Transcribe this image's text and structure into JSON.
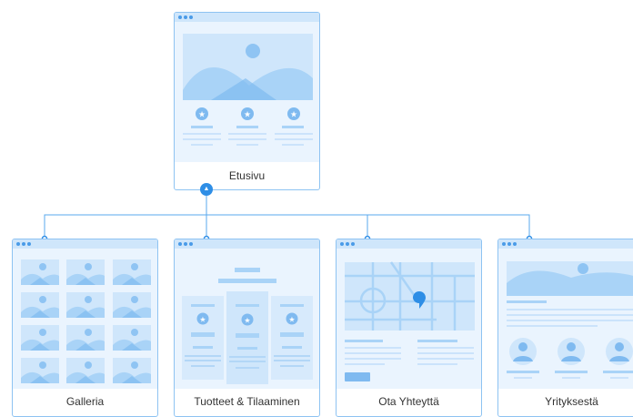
{
  "pages": {
    "home": {
      "label": "Etusivu"
    },
    "gallery": {
      "label": "Galleria"
    },
    "products": {
      "label": "Tuotteet & Tilaaminen"
    },
    "contact": {
      "label": "Ota Yhteyttä"
    },
    "about": {
      "label": "Yrityksestä"
    }
  },
  "colors": {
    "accent": "#2e8ee6",
    "card_border": "#8ec3f2",
    "header_bar": "#cfe6fb",
    "panel": "#eaf4fe",
    "wire_light": "#cbe3fb",
    "wire_mid": "#b3d7f7",
    "wire_dark": "#7fbaf0",
    "label_text": "#333333"
  },
  "icons": {
    "expand": "caret-up-icon",
    "star": "star-icon",
    "user": "user-icon",
    "map_pin": "map-pin-icon"
  }
}
